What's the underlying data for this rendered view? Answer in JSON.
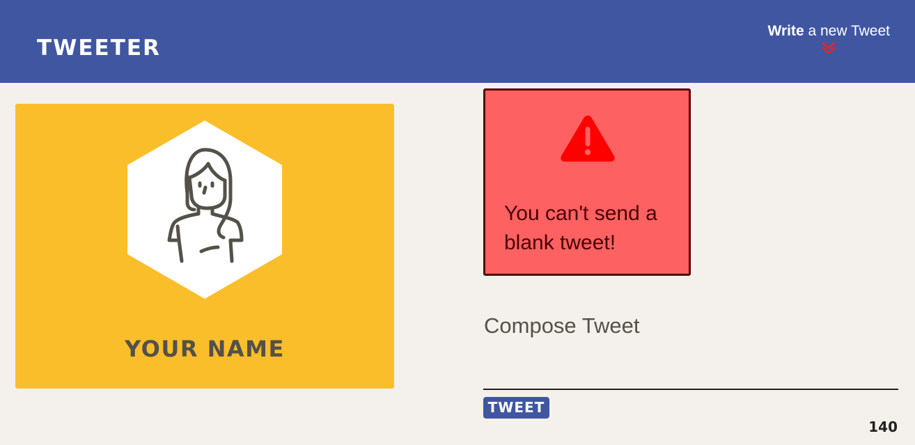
{
  "nav": {
    "brand": "TWEETER",
    "write_bold": "Write",
    "write_rest": " a new Tweet",
    "chevron_color": "#e0262b"
  },
  "profile": {
    "name": "YOUR NAME",
    "card_color": "#fbbe2b",
    "avatar_icon": "woman-avatar-icon"
  },
  "error": {
    "message": "You can't send a blank tweet!",
    "icon": "warning-icon",
    "bg_color": "#fd6161",
    "border_color": "#5a0000"
  },
  "compose": {
    "title": "Compose Tweet",
    "input_value": "",
    "button_label": "TWEET",
    "counter": "140"
  },
  "colors": {
    "navbar": "#4056a1",
    "background": "#f4f1ec",
    "text": "#545149"
  }
}
